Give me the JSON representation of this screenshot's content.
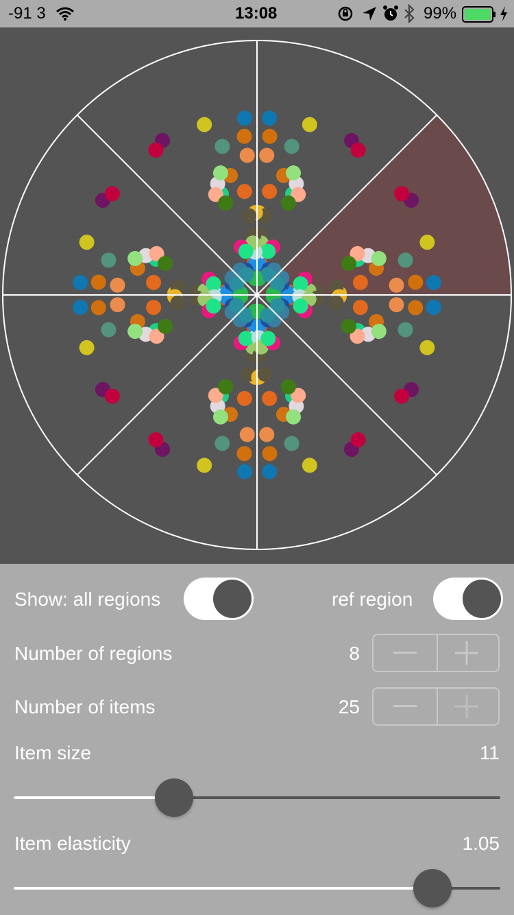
{
  "status_bar": {
    "signal": "-91 3",
    "time": "13:08",
    "battery_percent": "99%",
    "icons": [
      "wifi-icon",
      "rotation-lock-icon",
      "location-arrow-icon",
      "alarm-icon",
      "bluetooth-icon",
      "battery-icon",
      "charging-bolt-icon"
    ]
  },
  "canvas": {
    "background": "#545454",
    "regions": 8,
    "ref_region_color": "#6a4a4a",
    "line_color": "#ffffff"
  },
  "controls": {
    "show_all_regions_label": "Show: all regions",
    "show_all_regions_on": true,
    "ref_region_label": "ref region",
    "ref_region_on": true,
    "regions_label": "Number of regions",
    "regions_value": "8",
    "items_label": "Number of items",
    "items_value": "25",
    "item_size_label": "Item size",
    "item_size_value": "11",
    "item_size_fraction": 0.33,
    "elasticity_label": "Item elasticity",
    "elasticity_value": "1.05",
    "elasticity_fraction": 0.86
  }
}
